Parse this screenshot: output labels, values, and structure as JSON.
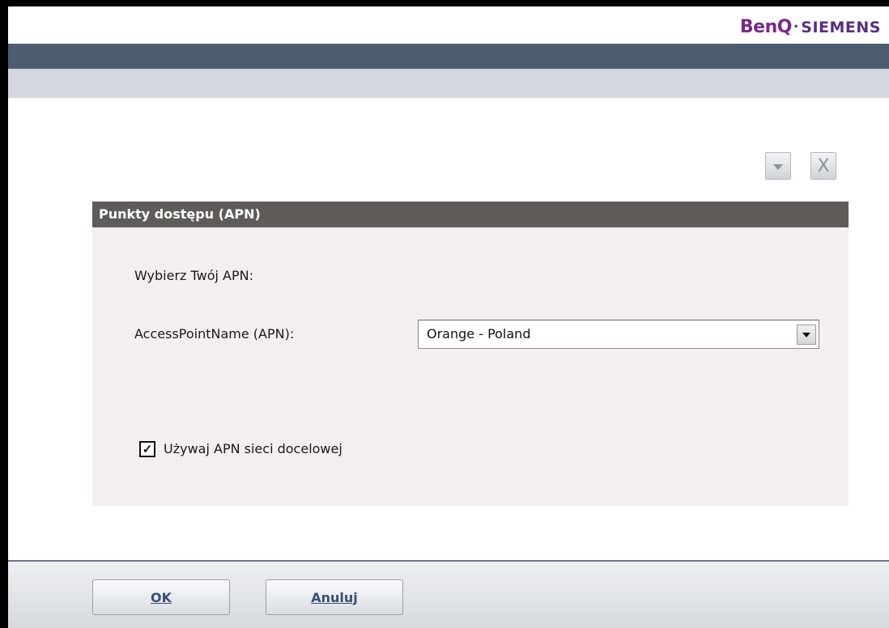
{
  "header": {
    "brand_left": "BenQ",
    "brand_dot": "·",
    "brand_right": "SIEMENS",
    "brand_left_color": "#7a2a8a",
    "brand_right_color": "#5a2d82"
  },
  "toolbar": {
    "dropdown_icon": "chevron-down-icon",
    "close_label": "X"
  },
  "panel": {
    "title": "Punkty dostępu (APN)",
    "prompt": "Wybierz Twój APN:",
    "apn_label": "AccessPointName (APN):",
    "apn_value": "Orange - Poland",
    "checkbox_checked": true,
    "checkbox_mark": "✓",
    "checkbox_label": "Używaj APN sieci docelowej"
  },
  "footer": {
    "ok_label": "OK",
    "cancel_label": "Anuluj"
  },
  "colors": {
    "dark_stripe": "#4c5d6f",
    "light_stripe": "#d4d8de",
    "panel_header": "#5e5b59",
    "panel_body": "#f4eeee",
    "button_text": "#3a4f74"
  }
}
